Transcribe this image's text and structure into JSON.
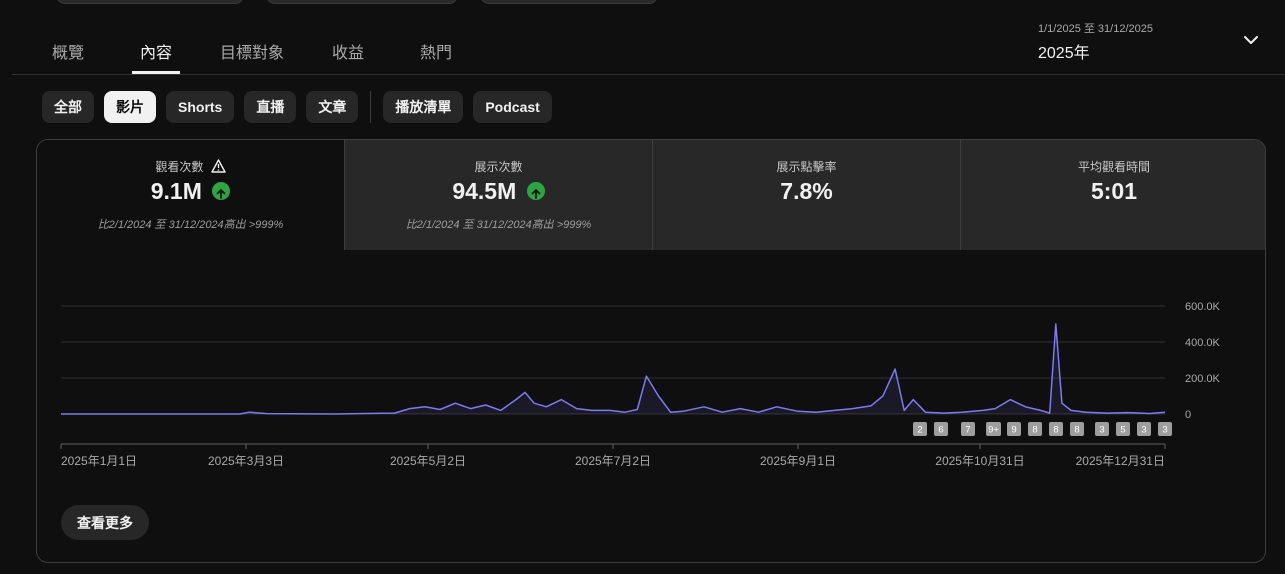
{
  "tabs": [
    {
      "label": "概覽",
      "active": false
    },
    {
      "label": "內容",
      "active": true
    },
    {
      "label": "目標對象",
      "active": false
    },
    {
      "label": "收益",
      "active": false
    },
    {
      "label": "熱門",
      "active": false
    }
  ],
  "date_range": {
    "sub": "1/1/2025 至 31/12/2025",
    "main": "2025年"
  },
  "chips": [
    {
      "label": "全部",
      "active": false
    },
    {
      "label": "影片",
      "active": true
    },
    {
      "label": "Shorts",
      "active": false
    },
    {
      "label": "直播",
      "active": false
    },
    {
      "label": "文章",
      "active": false
    },
    {
      "label": "播放清單",
      "active": false
    },
    {
      "label": "Podcast",
      "active": false
    }
  ],
  "metrics": [
    {
      "label": "觀看次數",
      "value": "9.1M",
      "comparison": "比2/1/2024 至 31/12/2024高出 >999%",
      "icon": "warning-icon"
    },
    {
      "label": "展示次數",
      "value": "94.5M",
      "comparison": "比2/1/2024 至 31/12/2024高出 >999%"
    },
    {
      "label": "展示點擊率",
      "value": "7.8%"
    },
    {
      "label": "平均觀看時間",
      "value": "5:01"
    }
  ],
  "colors": {
    "line": "#7f79f7",
    "positive": "#2ba640"
  },
  "chart_data": {
    "type": "line",
    "series": [
      {
        "x": [
          "2025-01-01",
          "2025-02-01",
          "2025-03-01",
          "2025-03-04",
          "2025-03-10",
          "2025-04-01",
          "2025-04-21",
          "2025-04-26",
          "2025-05-01",
          "2025-05-06",
          "2025-05-11",
          "2025-05-16",
          "2025-05-21",
          "2025-05-26",
          "2025-05-31",
          "2025-06-03",
          "2025-06-06",
          "2025-06-10",
          "2025-06-15",
          "2025-06-20",
          "2025-06-25",
          "2025-07-01",
          "2025-07-06",
          "2025-07-10",
          "2025-07-13",
          "2025-07-17",
          "2025-07-21",
          "2025-07-25",
          "2025-08-01",
          "2025-08-07",
          "2025-08-13",
          "2025-08-19",
          "2025-08-25",
          "2025-09-01",
          "2025-09-07",
          "2025-09-13",
          "2025-09-19",
          "2025-09-25",
          "2025-09-29",
          "2025-10-03",
          "2025-10-06",
          "2025-10-09",
          "2025-10-13",
          "2025-10-19",
          "2025-10-25",
          "2025-11-01",
          "2025-11-05",
          "2025-11-10",
          "2025-11-15",
          "2025-11-20",
          "2025-11-23",
          "2025-11-25",
          "2025-11-27",
          "2025-11-30",
          "2025-12-05",
          "2025-12-12",
          "2025-12-19",
          "2025-12-26",
          "2025-12-31"
        ],
        "values": [
          0,
          0,
          0,
          10000,
          2000,
          0,
          5000,
          30000,
          40000,
          25000,
          60000,
          30000,
          50000,
          20000,
          80000,
          120000,
          60000,
          40000,
          80000,
          30000,
          20000,
          20000,
          10000,
          25000,
          210000,
          100000,
          10000,
          15000,
          40000,
          10000,
          30000,
          10000,
          40000,
          15000,
          10000,
          20000,
          30000,
          45000,
          100000,
          250000,
          20000,
          80000,
          10000,
          5000,
          10000,
          20000,
          30000,
          80000,
          40000,
          20000,
          5000,
          500000,
          60000,
          20000,
          10000,
          5000,
          8000,
          3000,
          10000
        ]
      }
    ],
    "x_tick_labels": [
      "2025年1月1日",
      "2025年3月3日",
      "2025年5月2日",
      "2025年7月2日",
      "2025年9月1日",
      "2025年10月31日",
      "2025年12月31日"
    ],
    "y_tick_labels": [
      "600.0K",
      "400.0K",
      "200.0K",
      "0"
    ],
    "ylim": [
      0,
      600000
    ],
    "grid": true,
    "markers": [
      "2",
      "6",
      "7",
      "9+",
      "9",
      "8",
      "8",
      "8",
      "3",
      "5",
      "3",
      "3"
    ]
  },
  "see_more_label": "查看更多"
}
